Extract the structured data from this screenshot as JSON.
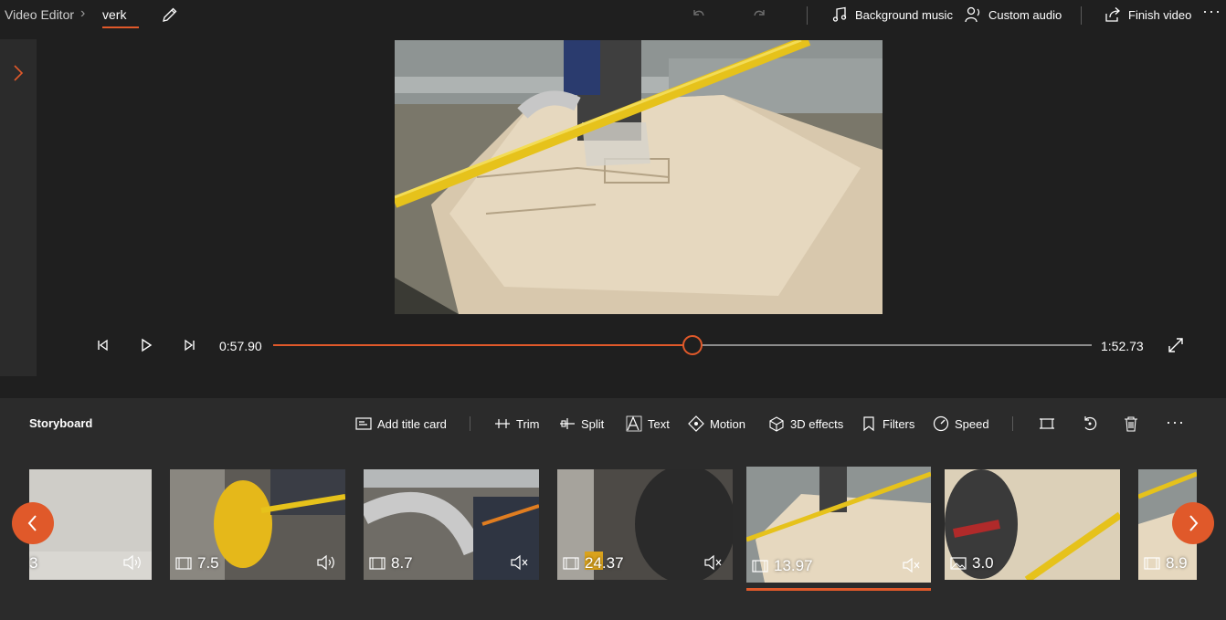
{
  "breadcrumb": {
    "root": "Video Editor",
    "current": "verk"
  },
  "toolbar": {
    "background_music": "Background music",
    "custom_audio": "Custom audio",
    "finish_video": "Finish video",
    "more": "···"
  },
  "player": {
    "current_time": "0:57.90",
    "total_time": "1:52.73",
    "progress": 0.512
  },
  "storyboard": {
    "title": "Storyboard",
    "actions": {
      "add_title_card": "Add title card",
      "trim": "Trim",
      "split": "Split",
      "text": "Text",
      "motion": "Motion",
      "effects_3d": "3D effects",
      "filters": "Filters",
      "speed": "Speed"
    },
    "more": "···",
    "clips": [
      {
        "duration": "3",
        "type": "none",
        "audio": "on"
      },
      {
        "duration": "7.5",
        "type": "video",
        "audio": "on"
      },
      {
        "duration": "8.7",
        "type": "video",
        "audio": "muted"
      },
      {
        "duration": "24.37",
        "type": "video",
        "audio": "muted"
      },
      {
        "duration": "13.97",
        "type": "video",
        "audio": "muted",
        "selected": true
      },
      {
        "duration": "3.0",
        "type": "image",
        "audio": "none"
      },
      {
        "duration": "8.9",
        "type": "video",
        "audio": "none"
      }
    ]
  },
  "colors": {
    "accent": "#e0592a",
    "background": "#1f1f1f",
    "panel": "#2b2b2b"
  }
}
